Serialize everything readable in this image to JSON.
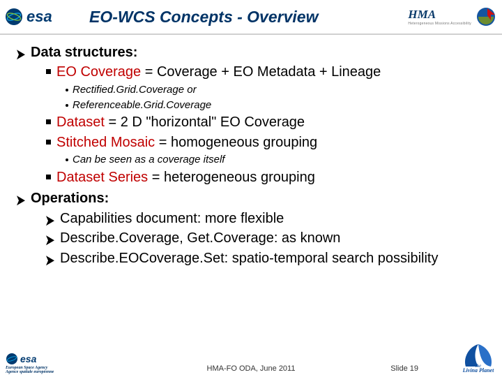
{
  "header": {
    "title": "EO-WCS Concepts - Overview",
    "logo_left": "esa",
    "logo_right": "HMA",
    "logo_right_sub": "Heterogeneous Missions Accessibility"
  },
  "content": {
    "item1Label": "Data structures:",
    "eoCoverageTerm": "EO Coverage",
    "eoCoverageRest": " = Coverage + EO Metadata + Lineage",
    "rectified": "Rectified.Grid.Coverage or",
    "referenceable": "Referenceable.Grid.Coverage",
    "datasetTerm": "Dataset",
    "datasetRest": " = 2 D \"horizontal\" EO Coverage",
    "stitchedTerm": "Stitched Mosaic",
    "stitchedRest": " = homogeneous grouping",
    "coverageItself": "Can be seen as a coverage itself",
    "seriesTerm": "Dataset Series",
    "seriesRest": " = heterogeneous grouping",
    "item2Label": "Operations:",
    "op1": "Capabilities document:  more flexible",
    "op2": "Describe.Coverage, Get.Coverage:  as known",
    "op3": "Describe.EOCoverage.Set:  spatio-temporal search possibility"
  },
  "footer": {
    "esa1": "European Space Agency",
    "esa2": "Agence spatiale européenne",
    "center": "HMA-FO ODA, June 2011",
    "slide": "Slide 19",
    "living": "the Living Planet"
  }
}
